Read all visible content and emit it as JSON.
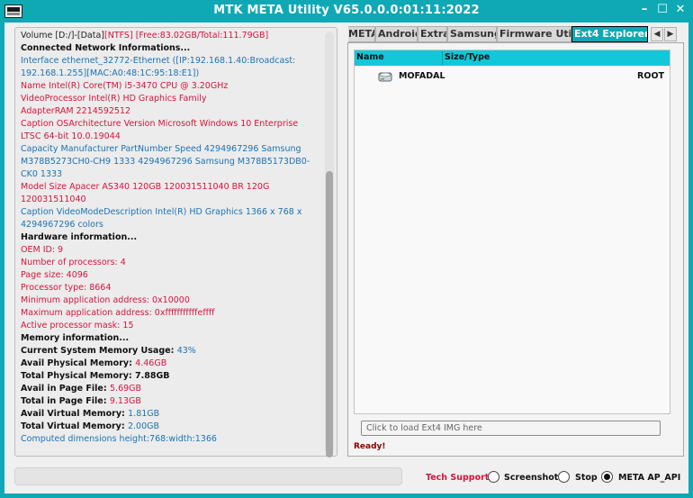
{
  "window": {
    "title": "MTK META Utility V65.0.0.0:01:11:2022",
    "controls": [
      "minimize-icon",
      "maximize-icon",
      "close-icon"
    ]
  },
  "log": {
    "volume_prefix": "Volume [D:/]-[Data]",
    "volume_fs": "[NTFS]",
    "volume_space": " [Free:83.02GB/Total:111.79GB]",
    "lines": [
      {
        "text": "Connected Network Informations...",
        "style": "black"
      },
      {
        "text": "Interface ethernet_32772-Ethernet ([IP:192.168.1.40:Broadcast: 192.168.1.255][MAC:A0:48:1C:95:18:E1])",
        "style": "blue",
        "rows": 2
      },
      {
        "text": "Name Intel(R) Core(TM) i5-3470 CPU @ 3.20GHz",
        "style": "red"
      },
      {
        "text": "VideoProcessor Intel(R) HD Graphics Family",
        "style": "red"
      },
      {
        "text": "AdapterRAM 2214592512",
        "style": "red"
      },
      {
        "text": "Caption OSArchitecture Version Microsoft Windows 10 Enterprise LTSC 64-bit 10.0.19044",
        "style": "red",
        "rows": 2
      },
      {
        "text": "Capacity Manufacturer PartNumber Speed 4294967296 Samsung M378B5273CH0-CH9 1333 4294967296 Samsung M378B5173DB0-CK0 1333",
        "style": "blue",
        "rows": 3
      },
      {
        "text": "Model Size Apacer AS340 120GB 120031511040 BR 120G 120031511040",
        "style": "red",
        "rows": 2
      },
      {
        "text": "Caption VideoModeDescription Intel(R) HD Graphics 1366 x 768 x 4294967296 colors",
        "style": "blue",
        "rows": 2
      },
      {
        "text": "Hardware information...",
        "style": "black"
      },
      {
        "text": "OEM ID: 9",
        "style": "red"
      },
      {
        "text": "Number of processors: 4",
        "style": "red"
      },
      {
        "text": "Page size: 4096",
        "style": "red"
      },
      {
        "text": "Processor type: 8664",
        "style": "red"
      },
      {
        "text": "Minimum application address: 0x10000",
        "style": "red"
      },
      {
        "text": "Maximum application address: 0xfffffffffffeffff",
        "style": "red"
      },
      {
        "text": "Active processor mask: 15",
        "style": "red"
      }
    ],
    "memory_header": "Memory information...",
    "memory_lines": [
      {
        "label": "Current System Memory Usage: ",
        "value": "43%",
        "value_style": "blue"
      },
      {
        "label": "Avail Physical Memory: ",
        "value": "4.46GB",
        "value_style": "red"
      },
      {
        "label": "Total Physical Memory: ",
        "value": "7.88GB",
        "value_style": "black"
      },
      {
        "label": "Avail in Page File: ",
        "value": "5.69GB",
        "value_style": "red"
      },
      {
        "label": "Total in Page File: ",
        "value": "9.13GB",
        "value_style": "red"
      },
      {
        "label": "Avail Virtual Memory: ",
        "value": "1.81GB",
        "value_style": "blue"
      },
      {
        "label": "Total Virtual Memory: ",
        "value": "2.00GB",
        "value_style": "blue"
      }
    ],
    "dimensions_line": "Computed dimensions height:768:width:1366"
  },
  "tabs": [
    {
      "label": "META"
    },
    {
      "label": "Android"
    },
    {
      "label": "Extra"
    },
    {
      "label": "Samsung"
    },
    {
      "label": "Firmware Utils"
    },
    {
      "label": "Ext4 Explorer",
      "active": true
    }
  ],
  "explorer": {
    "columns": {
      "name": "Name",
      "size_type": "Size/Type"
    },
    "rows": [
      {
        "name": "MOFADAL",
        "type": "ROOT",
        "icon": "hard-disk-icon"
      }
    ],
    "img_placeholder": "Click to load Ext4 IMG here",
    "status": "Ready!"
  },
  "bottom": {
    "progress": 0,
    "tech_support": "Tech Support",
    "options": [
      {
        "label": "Screenshot",
        "checked": false
      },
      {
        "label": "Stop",
        "checked": false
      },
      {
        "label": "META AP_API",
        "checked": true
      }
    ]
  },
  "colors": {
    "accent": "#0fa8b5",
    "header": "#12c7d8",
    "red_text": "#d6143c",
    "blue_text": "#1a73b5",
    "status": "#8b0000"
  }
}
